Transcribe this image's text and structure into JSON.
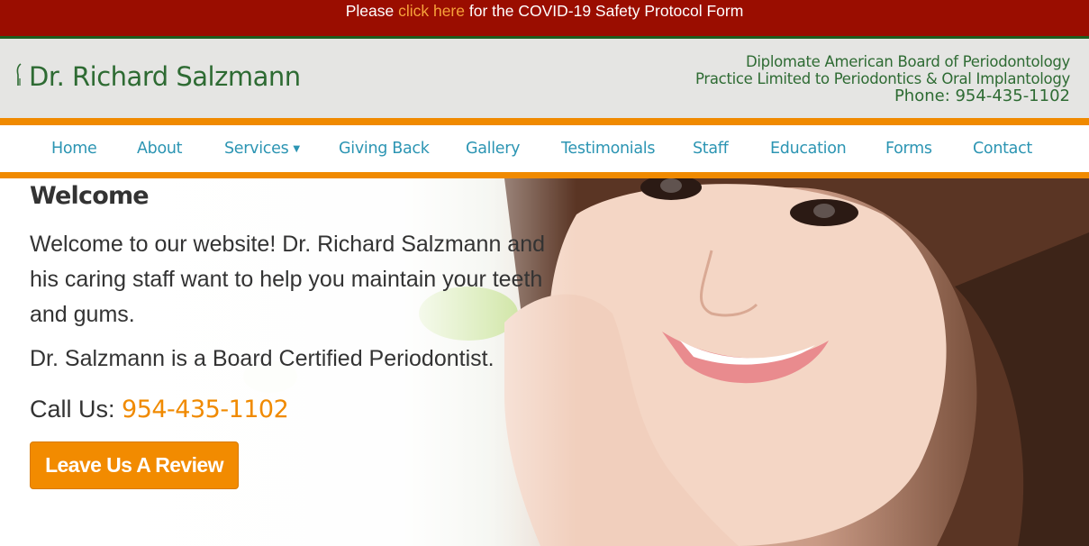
{
  "banner": {
    "prefix": "Please ",
    "link_text": "click here",
    "suffix": " for the COVID-19 Safety Protocol Form"
  },
  "header": {
    "logo_title": "Dr. Richard Salzmann",
    "logo_icon": "tooth-instrument-icon",
    "credential_line_1": "Diplomate American Board of Periodontology",
    "credential_line_2": "Practice Limited to Periodontics & Oral Implantology",
    "phone_line": "Phone: 954-435-1102"
  },
  "nav": {
    "items": [
      {
        "label": "Home"
      },
      {
        "label": "About"
      },
      {
        "label": "Services",
        "has_dropdown": true
      },
      {
        "label": "Giving Back"
      },
      {
        "label": "Gallery"
      },
      {
        "label": "Testimonials"
      },
      {
        "label": "Staff"
      },
      {
        "label": "Education"
      },
      {
        "label": "Forms"
      },
      {
        "label": "Contact"
      }
    ]
  },
  "hero": {
    "heading": "Welcome",
    "intro": "Welcome to our website! Dr. Richard Salzmann and his caring staff want to help you maintain your teeth and gums.",
    "board": "Dr. Salzmann is a Board Certified Periodontist.",
    "call_label": "Call Us: ",
    "call_phone": "954-435-1102",
    "review_button": "Leave Us A Review"
  },
  "colors": {
    "banner_bg": "#9a0d00",
    "banner_link": "#f7a23a",
    "brand_green": "#2e6b33",
    "accent_orange": "#f08a00",
    "nav_link": "#2c95b3",
    "header_bg": "#e5e5e3"
  }
}
